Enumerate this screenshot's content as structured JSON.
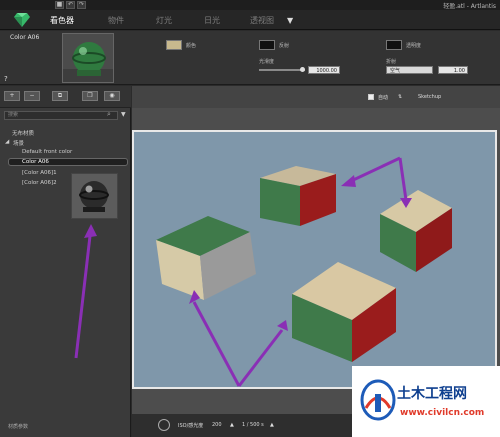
{
  "titlebar": {
    "save_icon": "save-icon",
    "undo_icon": "undo-icon",
    "redo_icon": "redo-icon",
    "file_title": "轻盈.atl - Artlantis"
  },
  "menubar": {
    "tabs": [
      {
        "label": "看色器",
        "active": true
      },
      {
        "label": "物件",
        "active": false
      },
      {
        "label": "灯光",
        "active": false
      },
      {
        "label": "日光",
        "active": false
      },
      {
        "label": "透视图",
        "active": false
      }
    ],
    "dropdown_glyph": "▼"
  },
  "props": {
    "material_name": "Color A06",
    "diffuse_label": "颜色",
    "reflection_label": "反射",
    "transparency_label": "透明度",
    "smoothness_label": "光滑度",
    "smoothness_value": "1000.00",
    "refraction_label": "折射",
    "refraction_option": "空气",
    "refraction_value": "1.00",
    "help_glyph": "?",
    "colors": {
      "diffuse": "#c8b98e",
      "reflection": "#111111",
      "transparency": "#111111"
    }
  },
  "left": {
    "search_placeholder": "搜索",
    "tree": {
      "root": "无布材质",
      "group": "场景",
      "items": [
        "Default front color",
        "Color A06",
        "[Color A06]1",
        "[Color A06]2"
      ],
      "selected": "Color A06"
    },
    "footer": "材质参数"
  },
  "viewport": {
    "toggle_label": "自动",
    "source_label": "Sketchup",
    "iso_label": "ISO/感光度",
    "iso_value": "200",
    "shutter_value": "1 / 500 s"
  },
  "watermark": {
    "text": "土木工程网",
    "url": "www.civilcn.com"
  }
}
